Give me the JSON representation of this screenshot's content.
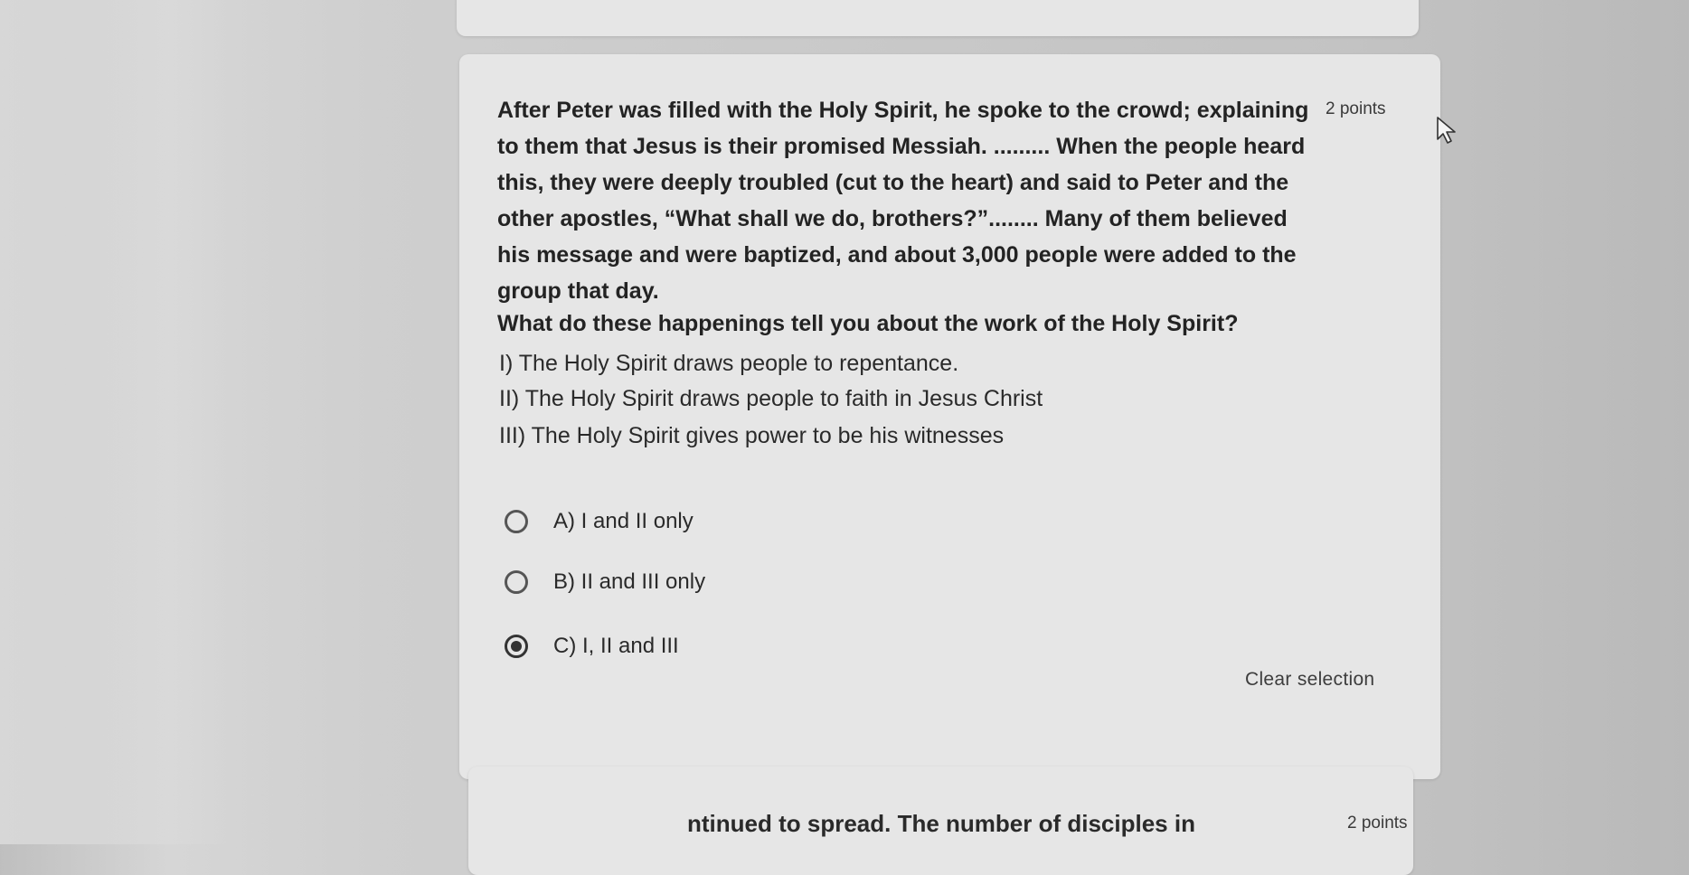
{
  "question": {
    "points": "2 points",
    "passage_lines": [
      "After Peter was filled with the Holy Spirit, he spoke to the crowd; explaining",
      "to them that Jesus is their promised Messiah. ......... When the people heard",
      "this, they were deeply troubled (cut to the heart) and said to Peter and the",
      "other apostles, “What shall we do, brothers?”........ Many of them believed",
      "his message and were baptized, and about 3,000 people were added to the",
      "group that day."
    ],
    "prompt": "What do these happenings tell you about the work of the Holy Spirit?",
    "statements": [
      "I)  The Holy Spirit draws people to repentance.",
      "II) The Holy Spirit draws people to faith in Jesus Christ",
      "III) The Holy Spirit gives power to be his witnesses"
    ],
    "options": [
      {
        "label": "A) I and II only",
        "selected": false
      },
      {
        "label": "B) II and III only",
        "selected": false
      },
      {
        "label": "C) I, II and III",
        "selected": true
      }
    ],
    "clear_label": "Clear selection"
  },
  "next_question": {
    "partial_text": "ntinued to spread. The number of disciples in",
    "points": "2 points"
  }
}
